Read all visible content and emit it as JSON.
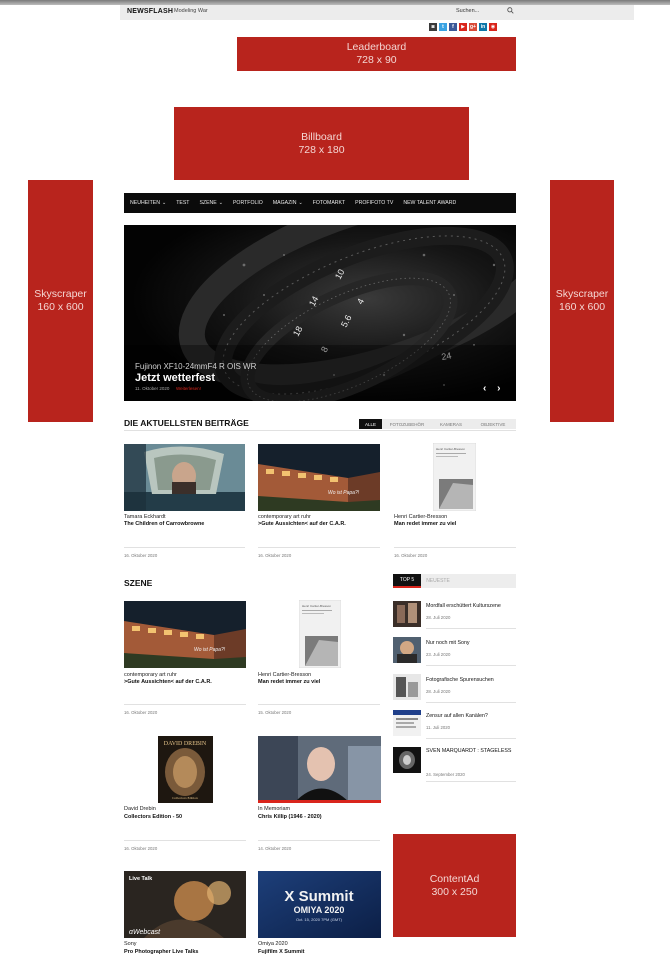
{
  "topbar": {
    "brand": "NEWSFLASH",
    "tagline": "Modeling War",
    "search_placeholder": "Suchen..."
  },
  "social": [
    {
      "icon": "camera-icon",
      "label": "◙",
      "color": "#3a3a3a"
    },
    {
      "icon": "twitter-icon",
      "label": "t",
      "color": "#3aa3e3"
    },
    {
      "icon": "facebook-icon",
      "label": "f",
      "color": "#3b5998"
    },
    {
      "icon": "youtube-icon",
      "label": "▶",
      "color": "#d9251c"
    },
    {
      "icon": "googleplus-icon",
      "label": "g+",
      "color": "#d84a38"
    },
    {
      "icon": "linkedin-icon",
      "label": "in",
      "color": "#0e76a8"
    },
    {
      "icon": "rss-icon",
      "label": "◉",
      "color": "#d9251c"
    }
  ],
  "ads": {
    "leaderboard": {
      "name": "Leaderboard",
      "size": "728 x 90"
    },
    "billboard": {
      "name": "Billboard",
      "size": "728 x 180"
    },
    "skyscraper_left": {
      "name": "Skyscraper",
      "size": "160 x 600"
    },
    "skyscraper_right": {
      "name": "Skyscraper",
      "size": "160 x 600"
    },
    "content": {
      "name": "ContentAd",
      "size": "300 x 250"
    }
  },
  "nav": [
    {
      "label": "NEUHEITEN",
      "dropdown": true
    },
    {
      "label": "TEST",
      "dropdown": false
    },
    {
      "label": "SZENE",
      "dropdown": true
    },
    {
      "label": "PORTFOLIO",
      "dropdown": false
    },
    {
      "label": "MAGAZIN",
      "dropdown": true
    },
    {
      "label": "FOTOMARKT",
      "dropdown": false
    },
    {
      "label": "PROFIFOTO TV",
      "dropdown": false
    },
    {
      "label": "NEW TALENT AWARD",
      "dropdown": false
    }
  ],
  "hero": {
    "subtitle": "Fujinon XF10-24mmF4 R OIS WR",
    "title": "Jetzt wetterfest",
    "date": "11. Oktober 2020",
    "more": "Weiterlesen!",
    "arrows": "‹ ›"
  },
  "latest": {
    "title": "DIE AKTUELLSTEN BEITRÄGE",
    "tabs": [
      "ALLE",
      "FOTOZUBEHÖR",
      "KAMERAS",
      "OBJEKTIVE"
    ],
    "items": [
      {
        "category": "Tamara Eckhardt",
        "title": "The Children of Carrowbrowne",
        "date": "16. Oktober 2020"
      },
      {
        "category": "contemporary art ruhr",
        "title": ">Gute Aussichten< auf der C.A.R.",
        "date": "16. Oktober 2020"
      },
      {
        "category": "Henri Cartier-Bresson",
        "title": "Man redet immer zu viel",
        "date": "16. Oktober 2020"
      }
    ]
  },
  "szene": {
    "title": "SZENE",
    "items": [
      {
        "category": "contemporary art ruhr",
        "title": ">Gute Aussichten< auf der C.A.R.",
        "date": "16. Oktober 2020"
      },
      {
        "category": "Henri Cartier-Bresson",
        "title": "Man redet immer zu viel",
        "date": "15. Oktober 2020"
      },
      {
        "category": "David Drebin",
        "title": "Collectors Edition - 50",
        "date": "16. Oktober 2020"
      },
      {
        "category": "In Memoriam",
        "title": "Chris Killip (1946 - 2020)",
        "date": "14. Oktober 2020"
      },
      {
        "category": "Sony",
        "title": "Pro Photographer Live Talks",
        "date": ""
      },
      {
        "category": "Omiya 2020",
        "title": "Fujifilm X Summit",
        "date": ""
      }
    ]
  },
  "top5": {
    "tabs": [
      "TOP 5",
      "NEUESTE"
    ],
    "items": [
      {
        "title": "Mordfall erschüttert Kulturszene",
        "date": "28. Juli 2020"
      },
      {
        "title": "Nur noch mit Sony",
        "date": "23. Juli 2020"
      },
      {
        "title": "Fotografische Spurensuchen",
        "date": "28. Juli 2020"
      },
      {
        "title": "Zensur auf allen Kanälen?",
        "date": "11. Juli 2020"
      },
      {
        "title": "SVEN MARQUARDT : STAGELESS",
        "date": "24. September 2020"
      }
    ]
  },
  "thumb_text": {
    "car_caption": "Wo ist Papa?!",
    "hcb_book": "Henri Cartier-Bresson",
    "drebin_book": "DAVID DREBIN",
    "drebin_sub": "Collectors Edition",
    "sony_live": "Live Talk",
    "sony_webcast": "αWebcast",
    "summit_title": "X Summit",
    "summit_city": "OMIYA 2020",
    "summit_date": "Oct. 15, 2020 7PM (GMT)"
  }
}
